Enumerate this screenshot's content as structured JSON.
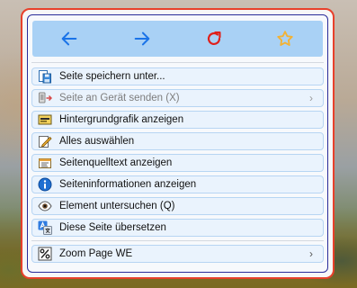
{
  "toolbar": {
    "back": {
      "icon": "back-arrow-icon",
      "color": "#1a73e8"
    },
    "forward": {
      "icon": "forward-arrow-icon",
      "color": "#1a73e8"
    },
    "reload": {
      "icon": "reload-icon",
      "color": "#e0201b"
    },
    "bookmark": {
      "icon": "star-icon",
      "color": "#f3b233"
    }
  },
  "menu": {
    "items": [
      {
        "label": "Seite speichern unter...",
        "icon": "save-page-icon",
        "disabled": false,
        "submenu": false
      },
      {
        "label": "Seite an Gerät senden (X)",
        "icon": "send-to-device-icon",
        "disabled": true,
        "submenu": true,
        "arrow": "›"
      },
      {
        "label": "Hintergrundgrafik anzeigen",
        "icon": "background-image-icon",
        "disabled": false,
        "submenu": false
      },
      {
        "label": "Alles auswählen",
        "icon": "select-all-icon",
        "disabled": false,
        "submenu": false
      },
      {
        "label": "Seitenquelltext anzeigen",
        "icon": "view-source-icon",
        "disabled": false,
        "submenu": false
      },
      {
        "label": "Seiteninformationen anzeigen",
        "icon": "info-icon",
        "disabled": false,
        "submenu": false
      },
      {
        "label": "Element untersuchen (Q)",
        "icon": "inspect-eye-icon",
        "disabled": false,
        "submenu": false
      },
      {
        "label": "Diese Seite übersetzen",
        "icon": "translate-icon",
        "disabled": false,
        "submenu": false
      },
      {
        "label": "Zoom Page WE",
        "icon": "zoom-percent-icon",
        "disabled": false,
        "submenu": true,
        "arrow": "›"
      }
    ]
  }
}
